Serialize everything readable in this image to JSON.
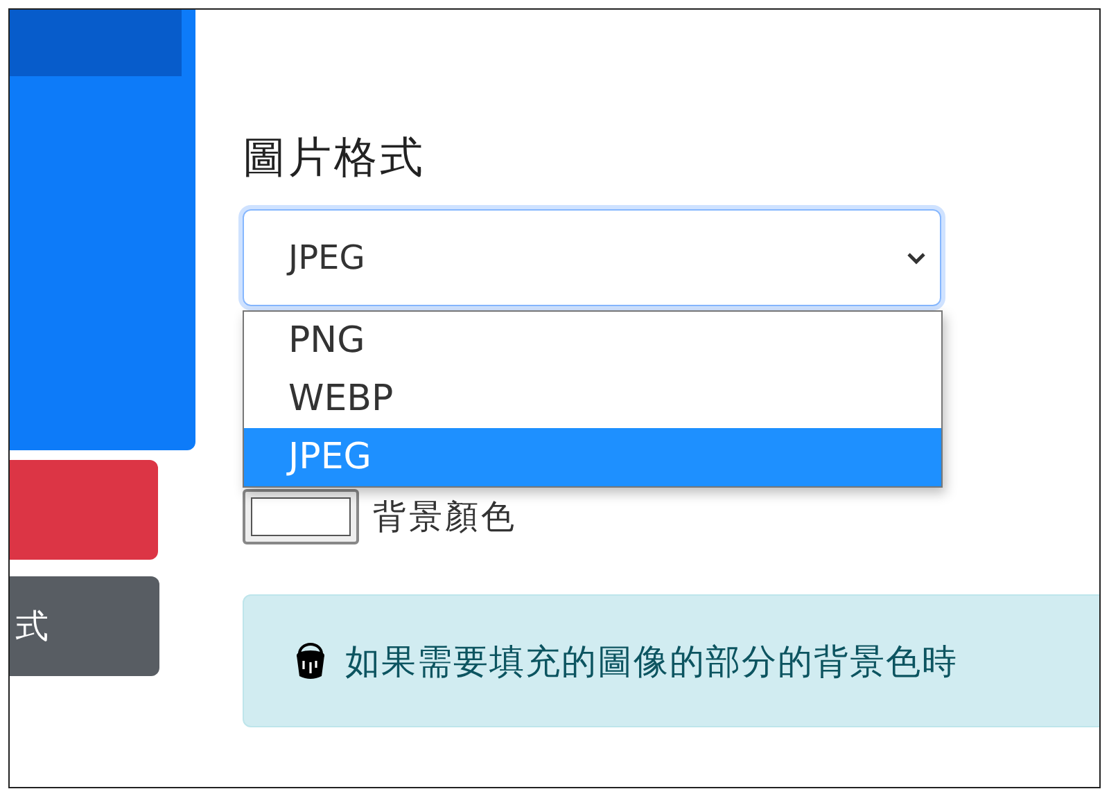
{
  "sidebar": {
    "buttons": [
      {
        "kind": "primary"
      },
      {
        "kind": "danger"
      },
      {
        "kind": "secondary",
        "label": "式"
      }
    ]
  },
  "format": {
    "label": "圖片格式",
    "value": "JPEG",
    "expanded": true,
    "options": [
      {
        "label": "PNG",
        "selected": false
      },
      {
        "label": "WEBP",
        "selected": false
      },
      {
        "label": "JPEG",
        "selected": true
      }
    ]
  },
  "background_color": {
    "label": "背景顏色"
  },
  "alert": {
    "text": "如果需要填充的圖像的部分的背景色時"
  }
}
